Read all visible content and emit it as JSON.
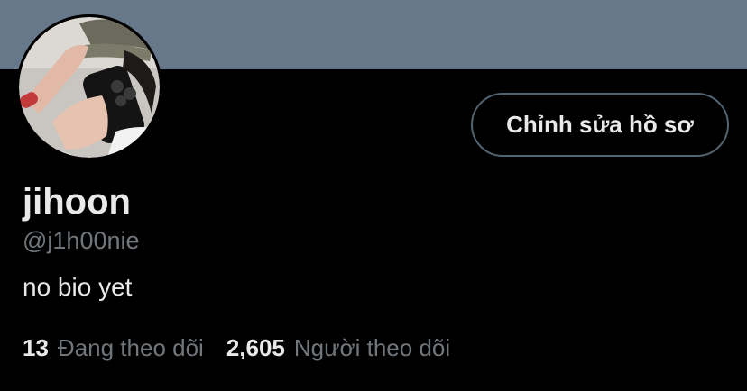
{
  "profile": {
    "display_name": "jihoon",
    "handle": "@j1h00nie",
    "bio": "no bio yet",
    "edit_button_label": "Chỉnh sửa hồ sơ",
    "avatar_icon": "profile-photo"
  },
  "stats": {
    "following_count": "13",
    "following_label": "Đang theo dõi",
    "followers_count": "2,605",
    "followers_label": "Người theo dõi"
  },
  "colors": {
    "banner": "#66788a",
    "background": "#000000",
    "primary_text": "#e7e9ea",
    "secondary_text": "#71767b",
    "button_border": "#536471"
  }
}
